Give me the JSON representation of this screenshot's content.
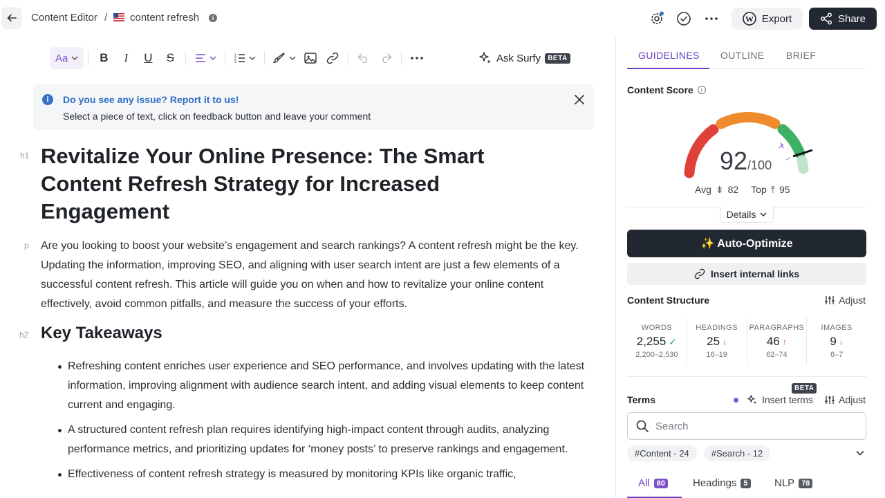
{
  "header": {
    "breadcrumb_root": "Content Editor",
    "breadcrumb_sep": "/",
    "doc_title": "content refresh",
    "export_label": "Export",
    "share_label": "Share"
  },
  "toolbar": {
    "font_label": "Aa",
    "ask_surfy_label": "Ask Surfy",
    "beta_badge": "BETA"
  },
  "notice": {
    "title": "Do you see any issue? Report it to us!",
    "text": "Select a piece of text, click on feedback button and leave your comment"
  },
  "document": {
    "h1_tag": "h1",
    "h1": "Revitalize Your Online Presence: The Smart Content Refresh Strategy for Increased Engagement",
    "p_tag": "p",
    "intro": "Are you looking to boost your website’s engagement and search rankings? A content refresh might be the key. Updating the information, improving SEO, and aligning with user search intent are just a few elements of a successful content refresh. This article will guide you on when and how to revitalize your online content effectively, avoid common pitfalls, and measure the success of your efforts.",
    "h2_tag": "h2",
    "h2": "Key Takeaways",
    "bullets": [
      "Refreshing content enriches user experience and SEO performance, and involves updating with the latest information, improving alignment with audience search intent, and adding visual elements to keep content current and engaging.",
      "A structured content refresh plan requires identifying high-impact content through audits, analyzing performance metrics, and prioritizing updates for ‘money posts’ to preserve rankings and engagement.",
      "Effectiveness of content refresh strategy is measured by monitoring KPIs like organic traffic,"
    ]
  },
  "panel": {
    "tabs": [
      "GUIDELINES",
      "OUTLINE",
      "BRIEF"
    ],
    "content_score_label": "Content Score",
    "score": "92",
    "score_max": "/100",
    "avg_label": "Avg",
    "avg_value": "82",
    "top_label": "Top",
    "top_value": "95",
    "details_label": "Details",
    "auto_optimize_label": "✨ Auto-Optimize",
    "insert_links_label": "Insert internal links",
    "structure_title": "Content Structure",
    "adjust_label": "Adjust",
    "stats": [
      {
        "label": "WORDS",
        "value": "2,255",
        "range": "2,200–2,530",
        "status": "ok"
      },
      {
        "label": "HEADINGS",
        "value": "25",
        "range": "16–19",
        "status": "down"
      },
      {
        "label": "PARAGRAPHS",
        "value": "46",
        "range": "62–74",
        "status": "up"
      },
      {
        "label": "IMAGES",
        "value": "9",
        "range": "6–7",
        "status": "down"
      }
    ],
    "terms_title": "Terms",
    "terms_beta": "BETA",
    "insert_terms_label": "Insert terms",
    "search_placeholder": "Search",
    "chips": [
      "#Content - 24",
      "#Search - 12"
    ],
    "filter_tabs": [
      {
        "label": "All",
        "count": "80"
      },
      {
        "label": "Headings",
        "count": "5"
      },
      {
        "label": "NLP",
        "count": "78"
      }
    ]
  },
  "colors": {
    "accent": "#6a41c2",
    "dark_button": "#222831",
    "gauge_red": "#e0403a",
    "gauge_orange": "#ef8b2c",
    "gauge_green": "#3db264"
  }
}
